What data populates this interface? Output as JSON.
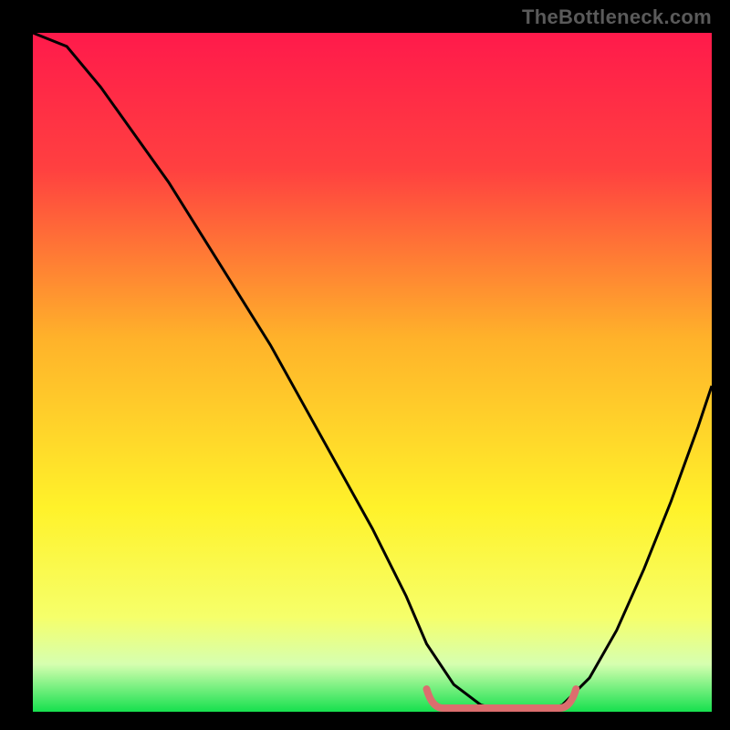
{
  "watermark": "TheBottleneck.com",
  "chart_data": {
    "type": "line",
    "title": "",
    "xlabel": "",
    "ylabel": "",
    "xlim": [
      0,
      100
    ],
    "ylim": [
      0,
      100
    ],
    "gradient_stops": [
      {
        "pct": 0,
        "color": "#ff1a4b"
      },
      {
        "pct": 20,
        "color": "#ff4040"
      },
      {
        "pct": 45,
        "color": "#ffb22a"
      },
      {
        "pct": 70,
        "color": "#fff22a"
      },
      {
        "pct": 86,
        "color": "#f6ff6a"
      },
      {
        "pct": 93,
        "color": "#d6ffb0"
      },
      {
        "pct": 100,
        "color": "#16e04e"
      }
    ],
    "series": [
      {
        "name": "bottleneck-curve",
        "x": [
          0,
          5,
          10,
          15,
          20,
          25,
          30,
          35,
          40,
          45,
          50,
          55,
          58,
          62,
          66,
          70,
          72,
          75,
          78,
          82,
          86,
          90,
          94,
          98,
          100
        ],
        "values": [
          100,
          98,
          92,
          85,
          78,
          70,
          62,
          54,
          45,
          36,
          27,
          17,
          10,
          4,
          1,
          0,
          0,
          0,
          1,
          5,
          12,
          21,
          31,
          42,
          48
        ]
      }
    ],
    "marker_band": {
      "color": "#db6e6e",
      "thickness": 8,
      "x_start": 58,
      "x_end": 80,
      "y_level": 0,
      "bump_height": 2
    }
  }
}
